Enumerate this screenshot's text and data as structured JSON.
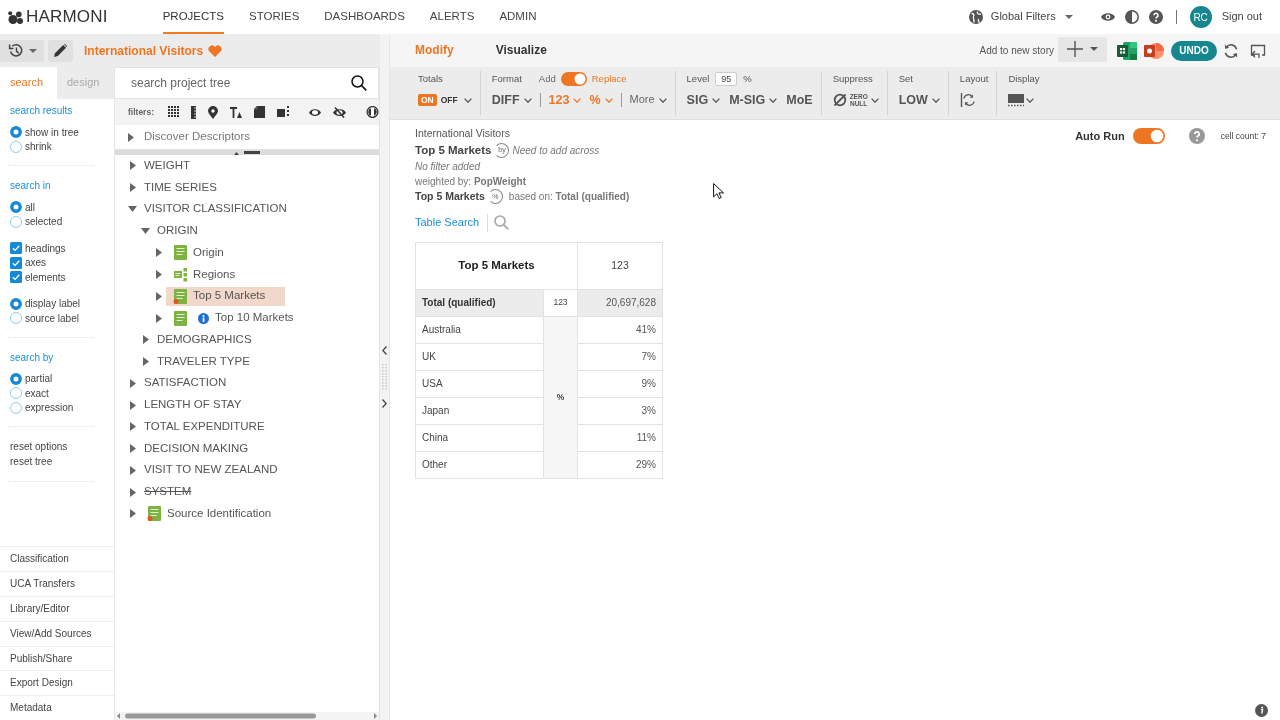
{
  "top_nav": {
    "logo": "HARMONI",
    "items": [
      {
        "label": "PROJECTS",
        "selected": true
      },
      {
        "label": "STORIES",
        "selected": false
      },
      {
        "label": "DASHBOARDS",
        "selected": false
      },
      {
        "label": "ALERTS",
        "selected": false
      },
      {
        "label": "ADMIN",
        "selected": false
      }
    ],
    "global_filters": "Global Filters",
    "avatar": "RC",
    "sign_out": "Sign out"
  },
  "project": {
    "title": "International Visitors",
    "favorite": true
  },
  "panel_tabs": [
    {
      "label": "search",
      "selected": true
    },
    {
      "label": "design",
      "selected": false
    }
  ],
  "search_sections": [
    {
      "heading": "search results",
      "groups": [
        [
          {
            "kind": "radio",
            "label": "show in tree",
            "checked": true
          },
          {
            "kind": "radio",
            "label": "shrink",
            "checked": false
          }
        ]
      ]
    },
    {
      "heading": "search in",
      "groups": [
        [
          {
            "kind": "radio",
            "label": "all",
            "checked": true
          },
          {
            "kind": "radio",
            "label": "selected",
            "checked": false
          }
        ],
        [
          {
            "kind": "checkbox",
            "label": "headings",
            "checked": true
          },
          {
            "kind": "checkbox",
            "label": "axes",
            "checked": true
          },
          {
            "kind": "checkbox",
            "label": "elements",
            "checked": true
          }
        ],
        [
          {
            "kind": "radio",
            "label": "display label",
            "checked": true
          },
          {
            "kind": "radio",
            "label": "source label",
            "checked": false
          }
        ]
      ]
    },
    {
      "heading": "search by",
      "groups": [
        [
          {
            "kind": "radio",
            "label": "partial",
            "checked": true
          },
          {
            "kind": "radio",
            "label": "exact",
            "checked": false
          },
          {
            "kind": "radio",
            "label": "expression",
            "checked": false
          }
        ]
      ]
    }
  ],
  "reset_links": [
    "reset options",
    "reset tree"
  ],
  "side_menu": [
    "Classification",
    "UCA Transfers",
    "Library/Editor",
    "View/Add Sources",
    "Publish/Share",
    "Export Design",
    "Metadata"
  ],
  "tree_search": {
    "placeholder": "search project tree"
  },
  "filters_label": "filters:",
  "discover": "Discover Descriptors",
  "tree": [
    {
      "label": "WEIGHT",
      "kind": "folder",
      "expanded": false,
      "selected": false,
      "struck": false
    },
    {
      "label": "TIME SERIES",
      "kind": "folder",
      "expanded": false,
      "selected": false,
      "struck": false
    },
    {
      "label": "VISITOR CLASSIFICATION",
      "kind": "folder",
      "expanded": true,
      "selected": false,
      "struck": false,
      "children": [
        {
          "label": "ORIGIN",
          "kind": "folder",
          "expanded": true,
          "selected": false,
          "struck": false,
          "children": [
            {
              "label": "Origin",
              "kind": "table",
              "expanded": false,
              "selected": false,
              "struck": false,
              "flagged": false,
              "info": false
            },
            {
              "label": "Regions",
              "kind": "hierarchy",
              "expanded": false,
              "selected": false,
              "struck": false,
              "flagged": false,
              "info": false
            },
            {
              "label": "Top 5 Markets",
              "kind": "table",
              "expanded": false,
              "selected": true,
              "struck": false,
              "flagged": true,
              "info": false
            },
            {
              "label": "Top 10 Markets",
              "kind": "table",
              "expanded": false,
              "selected": false,
              "struck": false,
              "flagged": false,
              "info": true
            }
          ]
        },
        {
          "label": "DEMOGRAPHICS",
          "kind": "folder",
          "expanded": false,
          "selected": false,
          "struck": false
        },
        {
          "label": "TRAVELER TYPE",
          "kind": "folder",
          "expanded": false,
          "selected": false,
          "struck": false
        }
      ]
    },
    {
      "label": "SATISFACTION",
      "kind": "folder",
      "expanded": false,
      "selected": false,
      "struck": false
    },
    {
      "label": "LENGTH OF STAY",
      "kind": "folder",
      "expanded": false,
      "selected": false,
      "struck": false
    },
    {
      "label": "TOTAL EXPENDITURE",
      "kind": "folder",
      "expanded": false,
      "selected": false,
      "struck": false
    },
    {
      "label": "DECISION MAKING",
      "kind": "folder",
      "expanded": false,
      "selected": false,
      "struck": false
    },
    {
      "label": "VISIT TO NEW ZEALAND",
      "kind": "folder",
      "expanded": false,
      "selected": false,
      "struck": false
    },
    {
      "label": "SYSTEM",
      "kind": "folder",
      "expanded": false,
      "selected": false,
      "struck": true
    },
    {
      "label": "Source Identification",
      "kind": "table",
      "expanded": false,
      "selected": false,
      "struck": false,
      "flagged": true,
      "info": false
    }
  ],
  "view_tabs": [
    {
      "label": "Modify",
      "selected": true
    },
    {
      "label": "Visualize",
      "selected": false
    }
  ],
  "add_story": "Add to new story",
  "undo": "UNDO",
  "toolbar": {
    "totals": {
      "label": "Totals",
      "options": [
        {
          "label": "ON",
          "selected": true
        },
        {
          "label": "OFF",
          "selected": false
        }
      ]
    },
    "format": {
      "label": "Format",
      "switch": [
        {
          "label": "Add",
          "selected": false
        },
        {
          "label": "Replace",
          "selected": true
        }
      ],
      "groups": [
        [
          {
            "kind": "menu",
            "label": "DIFF",
            "active": false
          }
        ],
        [
          {
            "kind": "menu",
            "label": "123",
            "active": true
          },
          {
            "kind": "menu",
            "label": "%",
            "active": true
          }
        ],
        [
          {
            "kind": "more",
            "label": "More",
            "active": false
          }
        ]
      ]
    },
    "level": {
      "label": "Level",
      "value": "95",
      "unit": "%",
      "items": [
        {
          "label": "SIG",
          "caret": true
        },
        {
          "label": "M-SIG",
          "caret": true
        },
        {
          "label": "MoE",
          "caret": false
        }
      ]
    },
    "suppress": {
      "label": "Suppress",
      "lines": [
        "ZERO",
        "NULL"
      ]
    },
    "set": {
      "label": "Set",
      "value": "LOW"
    },
    "layout": {
      "label": "Layout"
    },
    "display": {
      "label": "Display"
    }
  },
  "summary": {
    "project": "International Visitors",
    "table": "Top 5 Markets",
    "across_badge": "by",
    "across_note": "Need to add across",
    "filter_note": "No filter added",
    "weight": "weighted by: **PopWeight**",
    "base_table": "Top 5 Markets",
    "base_badge": "%",
    "base": "based on: **Total (qualified)**"
  },
  "table_search": "Table Search",
  "auto_run": {
    "label": "Auto Run",
    "on": true
  },
  "cell_count": "cell count: 7",
  "table": {
    "title": "Top 5 Markets",
    "column": "123",
    "total": {
      "label": "Total (qualified)",
      "stat": "123",
      "value": "20,697,628"
    },
    "stat": "%",
    "rows": [
      {
        "label": "Australia",
        "value": "41%"
      },
      {
        "label": "UK",
        "value": "7%"
      },
      {
        "label": "USA",
        "value": "9%"
      },
      {
        "label": "Japan",
        "value": "3%"
      },
      {
        "label": "China",
        "value": "11%"
      },
      {
        "label": "Other",
        "value": "29%"
      }
    ]
  }
}
